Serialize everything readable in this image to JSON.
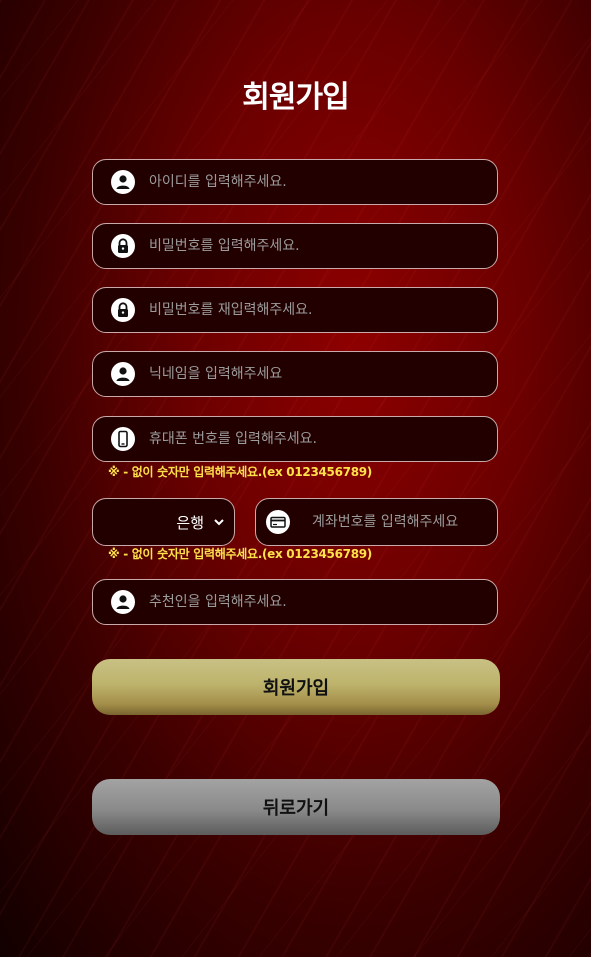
{
  "page": {
    "title": "회원가입"
  },
  "fields": {
    "user_id": {
      "placeholder": "아이디를 입력해주세요.",
      "icon": "user-icon"
    },
    "password": {
      "placeholder": "비밀번호를 입력해주세요.",
      "icon": "lock-icon"
    },
    "password_confirm": {
      "placeholder": "비밀번호를 재입력해주세요.",
      "icon": "lock-icon"
    },
    "nickname": {
      "placeholder": "닉네임을 입력해주세요",
      "icon": "user-icon"
    },
    "phone": {
      "placeholder": "휴대폰 번호를 입력해주세요.",
      "icon": "phone-icon"
    },
    "phone_notice": "※ - 없이 숫자만 입력해주세요.(ex 0123456789)",
    "bank": {
      "selected": "은행",
      "icon": "chevron-down-icon"
    },
    "account": {
      "placeholder": "계좌번호를 입력해주세요",
      "icon": "card-icon"
    },
    "account_notice": "※ - 없이 숫자만 입력해주세요.(ex 0123456789)",
    "referrer": {
      "placeholder": "추천인을 입력해주세요.",
      "icon": "user-icon"
    }
  },
  "buttons": {
    "join": "회원가입",
    "back": "뒤로가기"
  },
  "colors": {
    "background": "#6a0000",
    "field_bg": "#220000",
    "field_border": "#c9a9a9",
    "notice": "#ffe14a",
    "join_button": "#bdb36c",
    "back_button": "#8a8a8a"
  }
}
